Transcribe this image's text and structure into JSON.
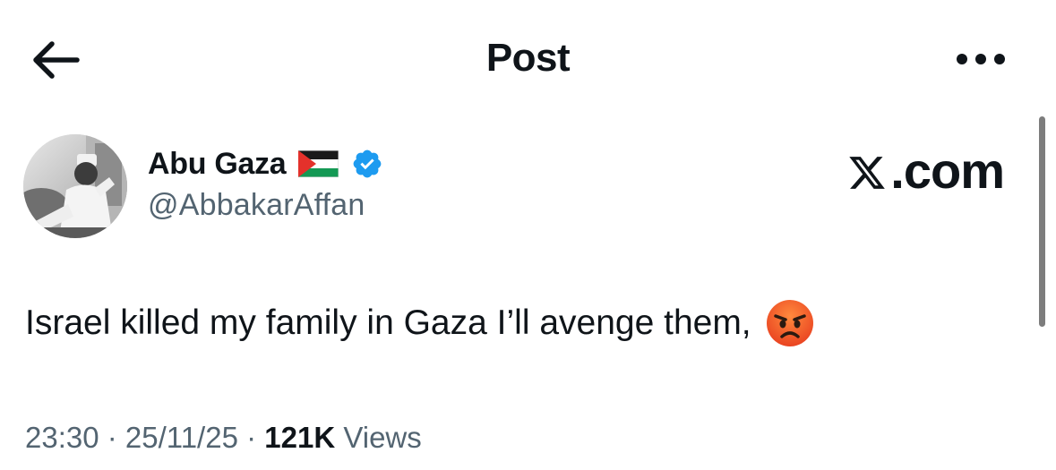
{
  "header": {
    "title": "Post",
    "back_icon": "arrow-left-icon",
    "more_icon": "more-dots-icon"
  },
  "author": {
    "name": "Abu Gaza",
    "handle": "@AbbakarAffan",
    "flag_icon": "palestine-flag-icon",
    "verified_icon": "verified-badge-icon",
    "verified_color": "#1d9bf0"
  },
  "watermark": {
    "text": ".com",
    "logo_icon": "x-logo-icon"
  },
  "post": {
    "text": "Israel killed my family in Gaza I’ll avenge them,",
    "emoji_icon": "angry-face-emoji"
  },
  "meta": {
    "time": "23:30",
    "separator": " · ",
    "date": "25/11/25",
    "views_count": "121K",
    "views_label": "Views"
  },
  "colors": {
    "text_primary": "#0f1419",
    "text_secondary": "#536471",
    "background": "#ffffff"
  }
}
